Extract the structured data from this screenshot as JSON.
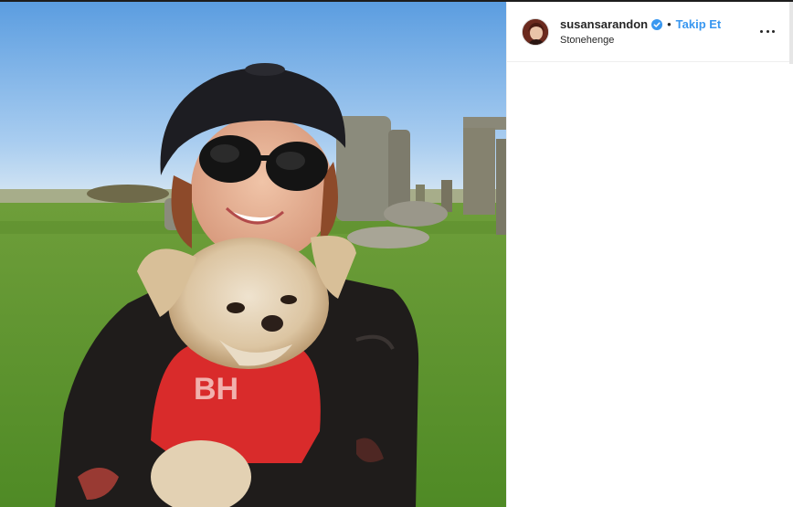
{
  "post": {
    "username": "susansarandon",
    "follow_label": "Takip Et",
    "separator": "•",
    "location": "Stonehenge",
    "verified_icon": "verified-badge-icon",
    "more_icon": "more-options-icon"
  },
  "colors": {
    "link_blue": "#3897f0",
    "text": "#262626",
    "divider": "#efefef"
  }
}
